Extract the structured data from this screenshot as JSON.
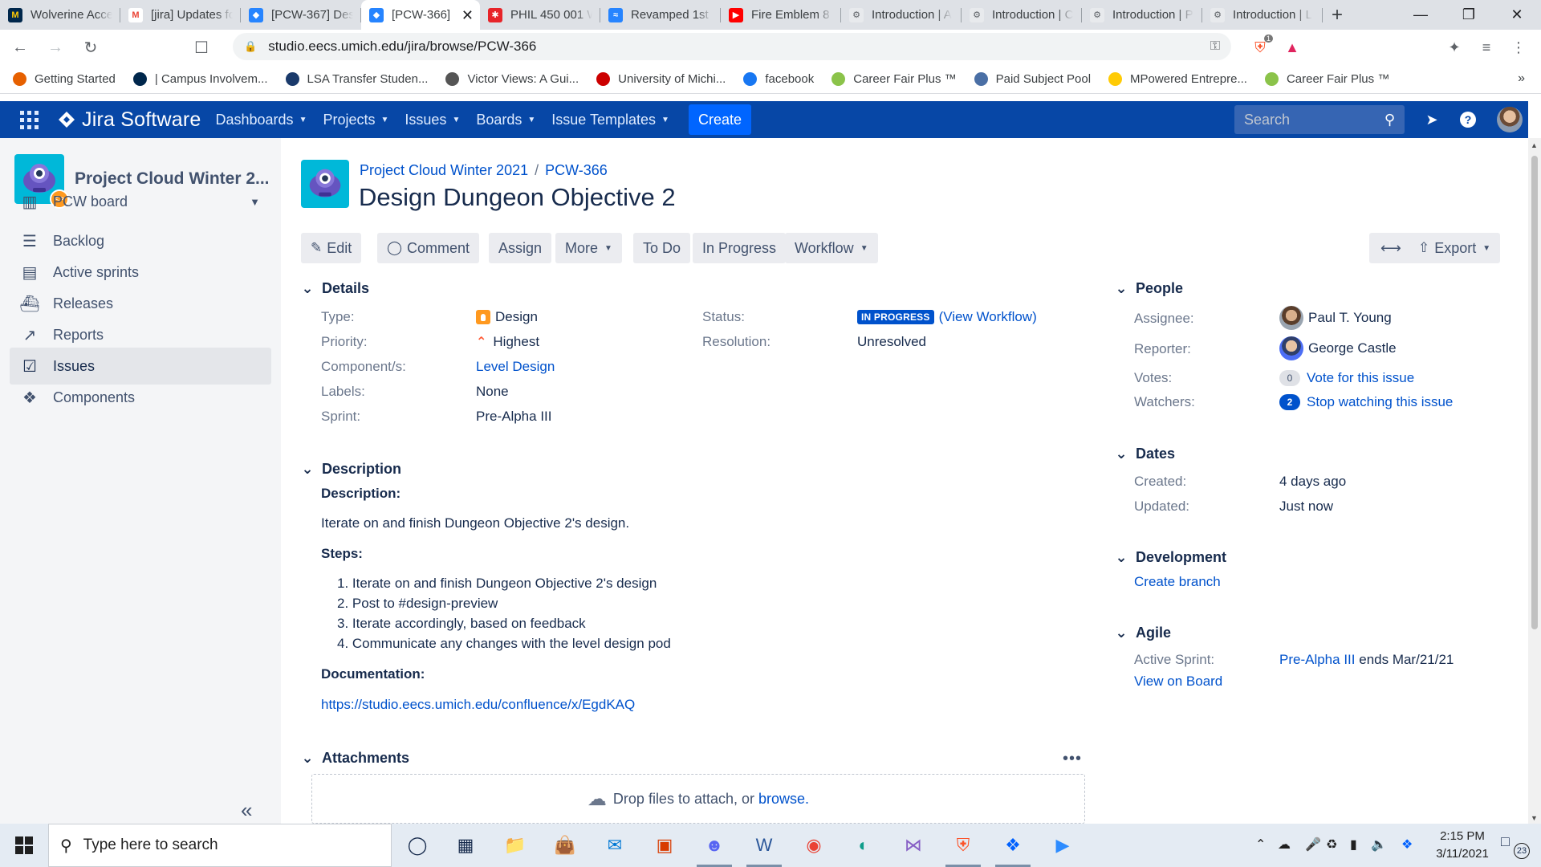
{
  "browser": {
    "tabs": [
      {
        "title": "Wolverine Acce",
        "icon": "umich-m-icon",
        "active": false
      },
      {
        "title": "[jira] Updates fo",
        "icon": "gmail-icon",
        "active": false
      },
      {
        "title": "[PCW-367] Des",
        "icon": "jira-icon",
        "active": false
      },
      {
        "title": "[PCW-366] ",
        "icon": "jira-icon",
        "active": true
      },
      {
        "title": "PHIL 450 001 W",
        "icon": "canvas-icon",
        "active": false
      },
      {
        "title": "Revamped 1st D",
        "icon": "confluence-icon",
        "active": false
      },
      {
        "title": "Fire Emblem 8 F",
        "icon": "youtube-icon",
        "active": false
      },
      {
        "title": "Introduction | A",
        "icon": "unity-icon",
        "active": false
      },
      {
        "title": "Introduction | C",
        "icon": "unity-icon",
        "active": false
      },
      {
        "title": "Introduction | P",
        "icon": "unity-icon",
        "active": false
      },
      {
        "title": "Introduction | L",
        "icon": "unity-icon",
        "active": false
      }
    ],
    "url": "studio.eecs.umich.edu/jira/browse/PCW-366",
    "bookmarks": [
      {
        "label": "Getting Started",
        "color": "#e66000"
      },
      {
        "label": "| Campus Involvem...",
        "color": "#00274c"
      },
      {
        "label": "LSA Transfer Studen...",
        "color": "#1a3a6b"
      },
      {
        "label": "Victor Views: A Gui...",
        "color": "#555555"
      },
      {
        "label": "University of Michi...",
        "color": "#cc0000"
      },
      {
        "label": "facebook",
        "color": "#1877f2"
      },
      {
        "label": "Career Fair Plus ™",
        "color": "#8bc34a"
      },
      {
        "label": "Paid Subject Pool",
        "color": "#4a6fa5"
      },
      {
        "label": "MPowered Entrepre...",
        "color": "#ffcb05"
      },
      {
        "label": "Career Fair Plus ™",
        "color": "#8bc34a"
      }
    ],
    "brave_badge": "1"
  },
  "jira_nav": {
    "product": "Jira Software",
    "menus": [
      "Dashboards",
      "Projects",
      "Issues",
      "Boards",
      "Issue Templates"
    ],
    "create_label": "Create",
    "search_placeholder": "Search"
  },
  "sidebar": {
    "project_name": "Project Cloud Winter 2...",
    "items": [
      {
        "label": "PCW board",
        "icon": "board-icon"
      },
      {
        "label": "Backlog",
        "icon": "backlog-icon"
      },
      {
        "label": "Active sprints",
        "icon": "sprints-icon"
      },
      {
        "label": "Releases",
        "icon": "releases-icon"
      },
      {
        "label": "Reports",
        "icon": "reports-icon"
      },
      {
        "label": "Issues",
        "icon": "issues-icon"
      },
      {
        "label": "Components",
        "icon": "components-icon"
      }
    ]
  },
  "issue": {
    "breadcrumb_project": "Project Cloud Winter 2021",
    "breadcrumb_sep": "/",
    "key": "PCW-366",
    "summary": "Design Dungeon Objective 2",
    "toolbar": {
      "edit": "Edit",
      "comment": "Comment",
      "assign": "Assign",
      "more": "More",
      "todo": "To Do",
      "in_progress": "In Progress",
      "workflow": "Workflow",
      "export": "Export"
    },
    "details": {
      "heading": "Details",
      "type_label": "Type:",
      "type_value": "Design",
      "priority_label": "Priority:",
      "priority_value": "Highest",
      "component_label": "Component/s:",
      "component_value": "Level Design",
      "labels_label": "Labels:",
      "labels_value": "None",
      "sprint_label": "Sprint:",
      "sprint_value": "Pre-Alpha III",
      "status_label": "Status:",
      "status_value": "IN PROGRESS",
      "view_workflow": "(View Workflow)",
      "resolution_label": "Resolution:",
      "resolution_value": "Unresolved"
    },
    "description": {
      "heading": "Description",
      "desc_title": "Description:",
      "desc_text": "Iterate on and finish Dungeon Objective 2's design.",
      "steps_title": "Steps:",
      "steps": [
        "1. Iterate on and finish Dungeon Objective 2's design",
        "2. Post to #design-preview",
        "3. Iterate accordingly, based on feedback",
        "4. Communicate any changes with the level design pod"
      ],
      "doc_title": "Documentation:",
      "doc_link": "https://studio.eecs.umich.edu/confluence/x/EgdKAQ"
    },
    "attachments": {
      "heading": "Attachments",
      "ellipsis": "•••",
      "drop_text": "Drop files to attach, or",
      "browse": "browse."
    },
    "people": {
      "heading": "People",
      "assignee_label": "Assignee:",
      "assignee": "Paul T. Young",
      "reporter_label": "Reporter:",
      "reporter": "George Castle",
      "votes_label": "Votes:",
      "votes_count": "0",
      "votes_link": "Vote for this issue",
      "watchers_label": "Watchers:",
      "watchers_count": "2",
      "watchers_link": "Stop watching this issue"
    },
    "dates": {
      "heading": "Dates",
      "created_label": "Created:",
      "created": "4 days ago",
      "updated_label": "Updated:",
      "updated": "Just now"
    },
    "development": {
      "heading": "Development",
      "create_branch": "Create branch"
    },
    "agile": {
      "heading": "Agile",
      "active_sprint_label": "Active Sprint:",
      "sprint_link": "Pre-Alpha III",
      "sprint_ends": "ends Mar/21/21",
      "view_on_board": "View on Board"
    }
  },
  "taskbar": {
    "search_placeholder": "Type here to search",
    "time": "2:15 PM",
    "date": "3/11/2021",
    "notifications": "23"
  }
}
